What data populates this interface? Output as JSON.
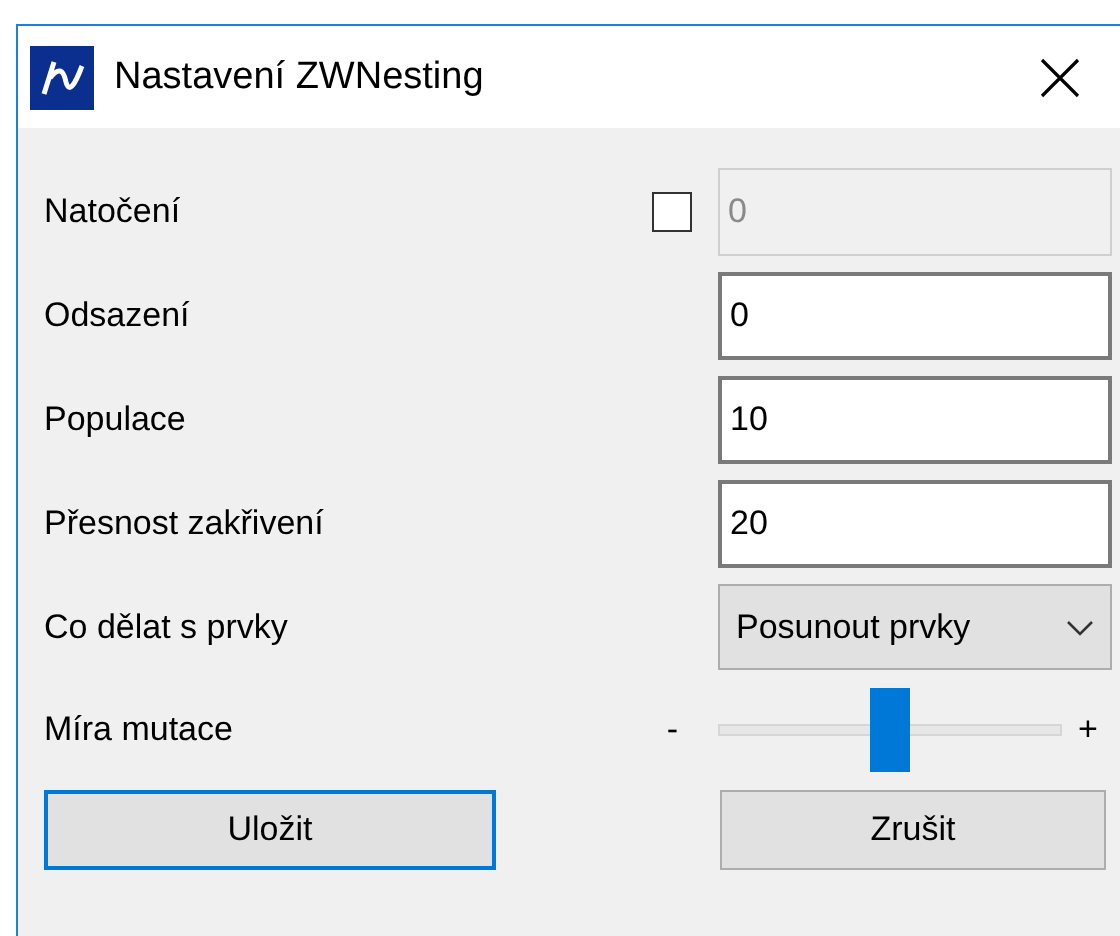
{
  "window": {
    "title": "Nastavení ZWNesting"
  },
  "fields": [
    {
      "kind": "checkbox-text",
      "label": "Natočení",
      "checked": false,
      "value": "0",
      "disabled": true
    },
    {
      "kind": "text",
      "label": "Odsazení",
      "value": "0"
    },
    {
      "kind": "text",
      "label": "Populace",
      "value": "10"
    },
    {
      "kind": "text",
      "label": "Přesnost zakřivení",
      "value": "20"
    },
    {
      "kind": "dropdown",
      "label": "Co dělat s prvky",
      "value": "Posunout prvky"
    },
    {
      "kind": "slider",
      "label": "Míra mutace",
      "min_label": "-",
      "max_label": "+",
      "level": 0.5
    }
  ],
  "buttons": [
    {
      "label": "Uložit",
      "default": true
    },
    {
      "label": "Zrušit",
      "default": false
    }
  ]
}
